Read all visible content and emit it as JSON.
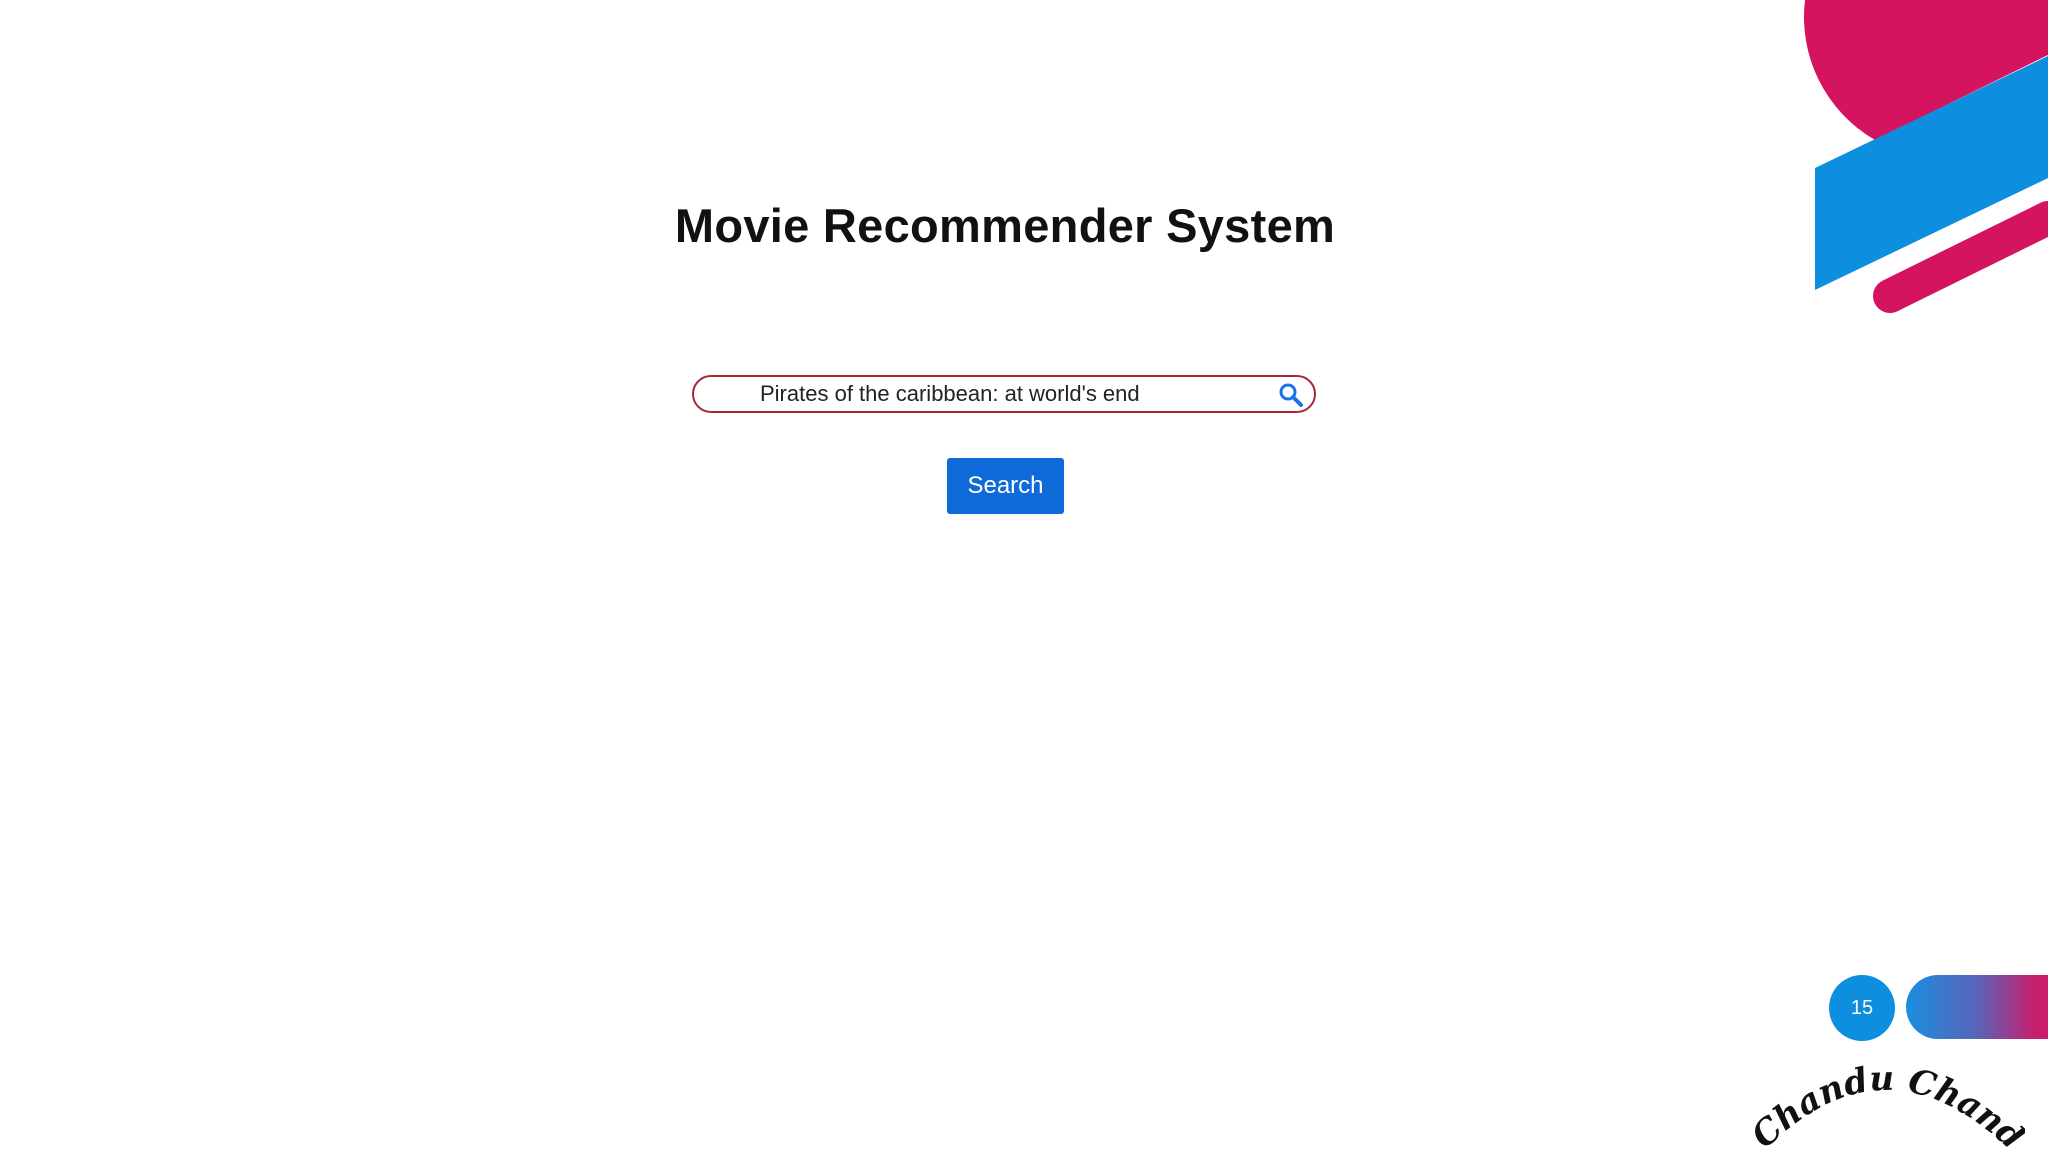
{
  "page": {
    "title": "Movie Recommender System",
    "slide_number": "15"
  },
  "search": {
    "value": "Pirates of the caribbean: at world's end",
    "button_label": "Search",
    "icon": "magnifier-icon"
  },
  "footer": {
    "signature": "Chandu Chandran"
  },
  "colors": {
    "magenta": "#D4145E",
    "blue": "#0D8EDE",
    "button_blue": "#0D6AD8",
    "search_border": "#A8283A"
  }
}
